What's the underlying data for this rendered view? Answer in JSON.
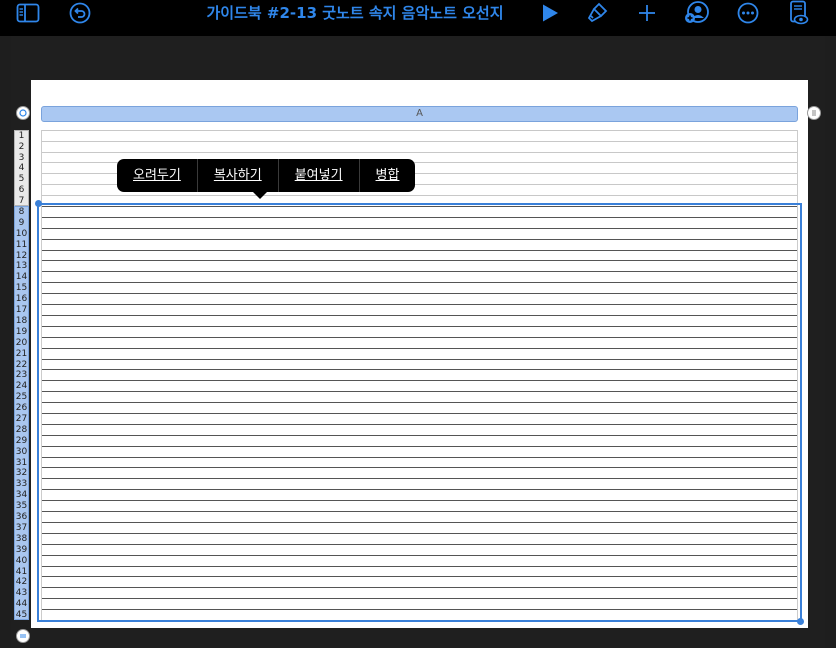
{
  "toolbar": {
    "title": "가이드북 #2-13 굿노트 속지 음악노트 오선지",
    "icons": [
      "sidebar-icon",
      "undo-icon",
      "play-icon",
      "format-brush-icon",
      "add-icon",
      "collaborate-icon",
      "more-icon",
      "document-view-icon"
    ],
    "accent_color": "#2f86ea"
  },
  "spreadsheet": {
    "column_label": "A",
    "row_count": 45,
    "selected_rows_label": "8 - 45",
    "selection_color": "#3a80d8"
  },
  "context_menu": {
    "items": [
      "오려두기",
      "복사하기",
      "붙여넣기",
      "병합"
    ]
  }
}
